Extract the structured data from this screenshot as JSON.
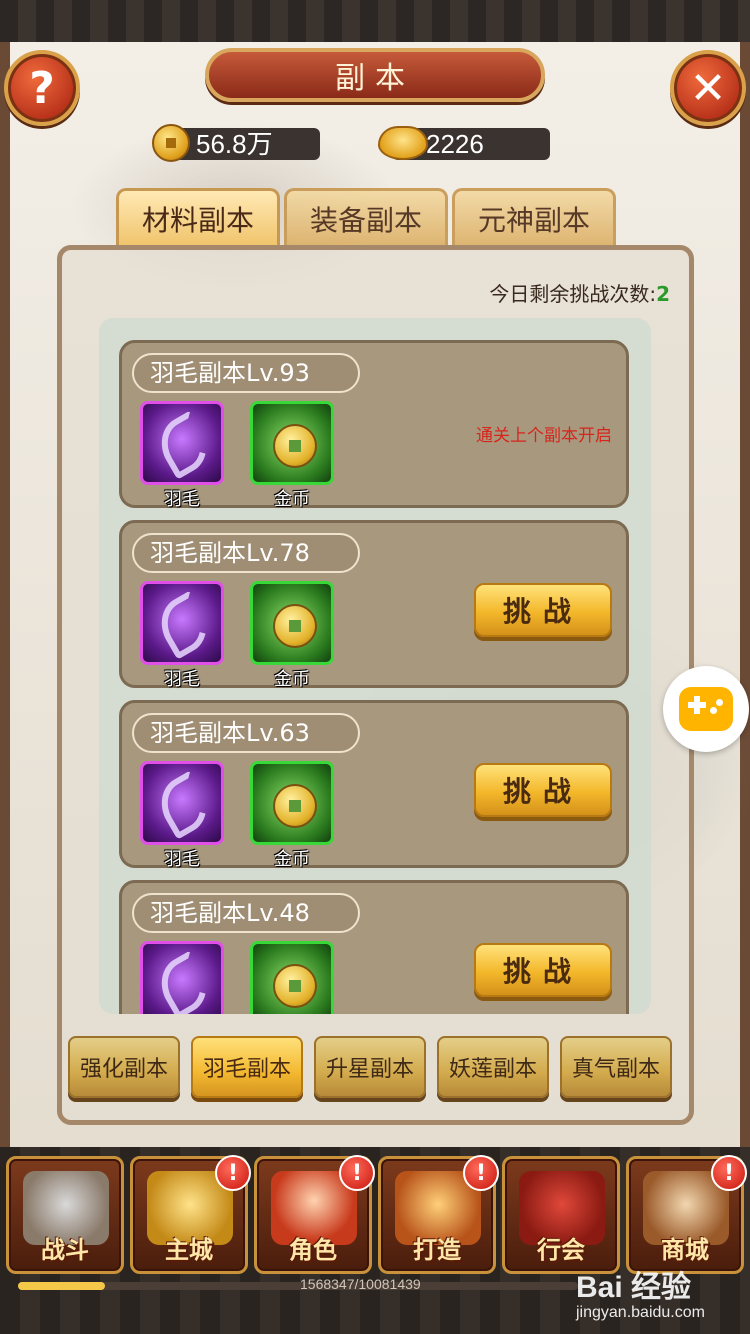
{
  "header": {
    "title": "副本"
  },
  "currency": {
    "coins": "56.8万",
    "ingots": "2226"
  },
  "tabs": [
    {
      "label": "材料副本",
      "active": true
    },
    {
      "label": "装备副本",
      "active": false
    },
    {
      "label": "元神副本",
      "active": false
    }
  ],
  "remaining": {
    "label": "今日剩余挑战次数:",
    "count": "2"
  },
  "dungeons": [
    {
      "title": "羽毛副本Lv.93",
      "rewards": [
        "羽毛",
        "金币"
      ],
      "status": "locked",
      "status_text": "通关上个副本开启"
    },
    {
      "title": "羽毛副本Lv.78",
      "rewards": [
        "羽毛",
        "金币"
      ],
      "status": "open",
      "button": "挑战"
    },
    {
      "title": "羽毛副本Lv.63",
      "rewards": [
        "羽毛",
        "金币"
      ],
      "status": "open",
      "button": "挑战"
    },
    {
      "title": "羽毛副本Lv.48",
      "rewards": [
        "羽毛",
        "金币"
      ],
      "status": "open",
      "button": "挑战"
    }
  ],
  "sub_tabs": [
    {
      "label": "强化副本",
      "active": false
    },
    {
      "label": "羽毛副本",
      "active": true
    },
    {
      "label": "升星副本",
      "active": false
    },
    {
      "label": "妖莲副本",
      "active": false
    },
    {
      "label": "真气副本",
      "active": false
    }
  ],
  "bottom_nav": [
    {
      "label": "战斗",
      "badge": false,
      "icon": "crossed-swords-icon"
    },
    {
      "label": "主城",
      "badge": true,
      "icon": "palace-icon"
    },
    {
      "label": "角色",
      "badge": true,
      "icon": "hero-portrait-icon"
    },
    {
      "label": "打造",
      "badge": true,
      "icon": "forge-icon"
    },
    {
      "label": "行会",
      "badge": false,
      "icon": "guild-banner-icon"
    },
    {
      "label": "商城",
      "badge": true,
      "icon": "shop-stall-icon"
    }
  ],
  "badge_symbol": "!",
  "experience": {
    "text": "1568347/10081439",
    "fraction": 0.1556
  },
  "watermark": {
    "brand": "Bai 经验",
    "url": "jingyan.baidu.com"
  },
  "icons": {
    "help": "?",
    "close": "✕"
  },
  "colors": {
    "accent_gold": "#f3b72a",
    "title_red": "#a8381f",
    "locked_red": "#d8251c",
    "count_green": "#2a9a2a"
  }
}
